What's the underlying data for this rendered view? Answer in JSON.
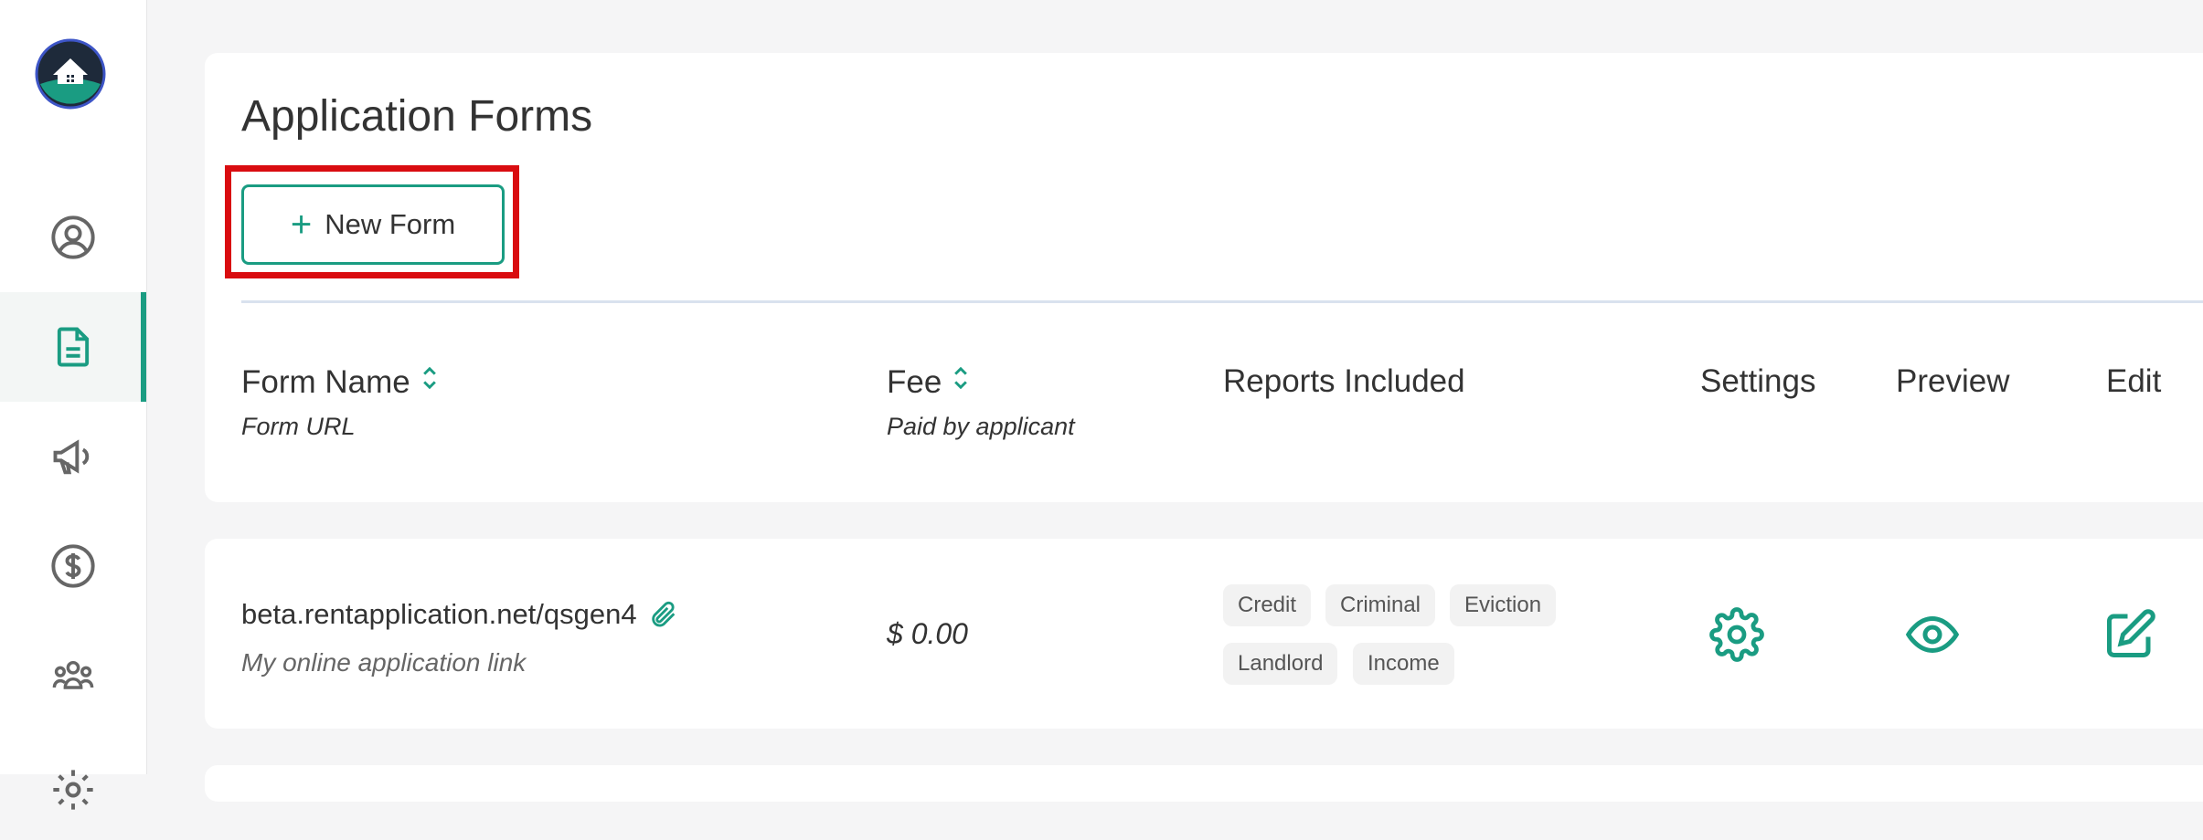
{
  "sidebar": {
    "logo": "house-logo-icon",
    "items": [
      {
        "icon": "user-circle-icon",
        "active": false
      },
      {
        "icon": "document-icon",
        "active": true
      },
      {
        "icon": "megaphone-icon",
        "active": false
      },
      {
        "icon": "dollar-circle-icon",
        "active": false
      },
      {
        "icon": "group-icon",
        "active": false
      },
      {
        "icon": "gear-icon",
        "active": false
      }
    ]
  },
  "page": {
    "title": "Application Forms",
    "new_form_label": "New Form"
  },
  "table": {
    "headers": {
      "form_name": "Form Name",
      "form_url": "Form URL",
      "fee": "Fee",
      "fee_sub": "Paid by applicant",
      "reports": "Reports Included",
      "settings": "Settings",
      "preview": "Preview",
      "edit": "Edit"
    },
    "rows": [
      {
        "url": "beta.rentapplication.net/qsgen4",
        "url_sub": "My online application link",
        "fee": "$ 0.00",
        "reports": [
          "Credit",
          "Criminal",
          "Eviction",
          "Landlord",
          "Income"
        ]
      }
    ]
  },
  "colors": {
    "accent": "#1a9c82",
    "highlight": "#d90c10",
    "background": "#f5f5f6"
  }
}
